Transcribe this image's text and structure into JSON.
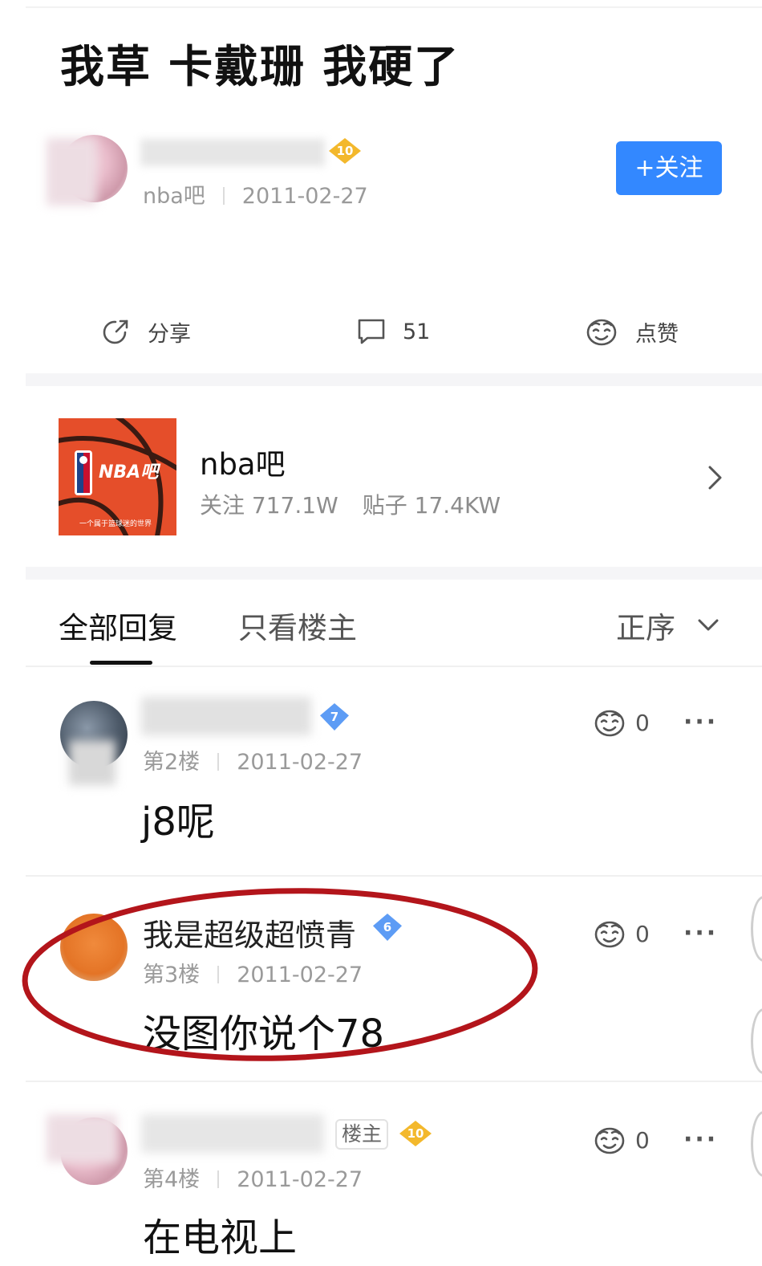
{
  "post": {
    "title": "我草 卡戴珊 我硬了",
    "author": {
      "name": "",
      "level": "10",
      "forum": "nba吧",
      "date": "2011-02-27"
    },
    "follow_label": "+关注",
    "actions": {
      "share_label": "分享",
      "comment_count": "51",
      "like_label": "点赞"
    }
  },
  "forum_card": {
    "logo_text": "NBA吧",
    "logo_tagline": "一个属于篮球迷的世界",
    "name": "nba吧",
    "followers": "关注 717.1W",
    "posts": "贴子 17.4KW"
  },
  "tabs": {
    "all": "全部回复",
    "op_only": "只看楼主",
    "sort": "正序"
  },
  "replies": [
    {
      "name": "",
      "level": "7",
      "floor": "第2楼",
      "date": "2011-02-27",
      "content": "j8呢",
      "likes": "0",
      "op_tag": ""
    },
    {
      "name": "我是超级超愤青",
      "level": "6",
      "floor": "第3楼",
      "date": "2011-02-27",
      "content": "没图你说个78",
      "likes": "0",
      "op_tag": ""
    },
    {
      "name": "",
      "level": "10",
      "floor": "第4楼",
      "date": "2011-02-27",
      "content": "在电视上",
      "likes": "0",
      "op_tag": "楼主"
    }
  ],
  "colors": {
    "accent": "#3388ff",
    "level_gold": "#f3b82c",
    "level_blue": "#5d9cf5",
    "highlight_ring": "#b3151b"
  }
}
